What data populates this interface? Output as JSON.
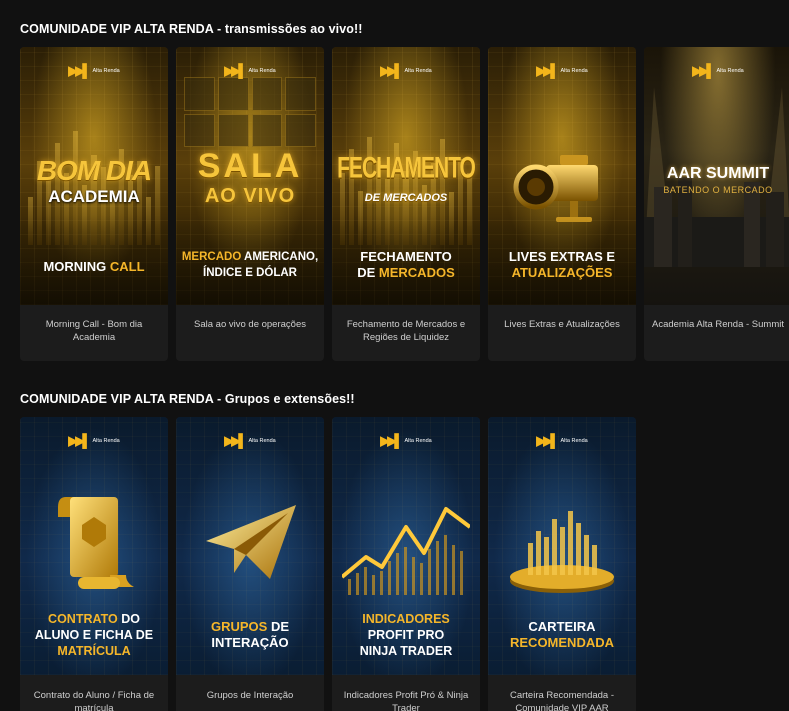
{
  "sections": [
    {
      "title": "COMUNIDADE VIP ALTA RENDA - transmissões ao vivo!!",
      "cards": [
        {
          "caption": "Morning Call - Bom dia Academia",
          "logo": "Alta Renda",
          "art_title": "BOM DIA",
          "art_sub": "ACADEMIA",
          "label_a": "MORNING ",
          "label_b": "CALL",
          "label_c": ""
        },
        {
          "caption": "Sala ao vivo de operações",
          "logo": "Alta Renda",
          "art_title": "SALA",
          "art_sub": "AO VIVO",
          "label_a": "MERCADO ",
          "label_b": "AMERICANO,",
          "label_c": "ÍNDICE E DÓLAR"
        },
        {
          "caption": "Fechamento de Mercados e Regiões de Liquidez",
          "logo": "Alta Renda",
          "art_title": "FECHAMENTO",
          "art_sub": "DE MERCADOS",
          "label_a": "FECHAMENTO",
          "label_b": "DE ",
          "label_c": "MERCADOS"
        },
        {
          "caption": "Lives Extras e Atualizações",
          "logo": "Alta Renda",
          "art_title": "",
          "art_sub": "",
          "label_a": "LIVES EXTRAS E",
          "label_b": "ATUALIZAÇÕES",
          "label_c": ""
        },
        {
          "caption": "Academia Alta Renda - Summit",
          "logo": "Alta Renda",
          "art_title": "AAR SUMMIT",
          "art_sub": "BATENDO O MERCADO",
          "label_a": "",
          "label_b": "",
          "label_c": ""
        }
      ]
    },
    {
      "title": "COMUNIDADE VIP ALTA RENDA - Grupos e extensões!!",
      "cards": [
        {
          "caption": "Contrato do Aluno / Ficha de matrícula",
          "logo": "Alta Renda",
          "label_a": "CONTRATO",
          "label_b": " DO",
          "label_c": "ALUNO E FICHA DE",
          "label_d": "MATRÍCULA"
        },
        {
          "caption": "Grupos de Interação",
          "logo": "Alta Renda",
          "label_a": "GRUPOS",
          "label_b": " DE",
          "label_c": "INTERAÇÃO",
          "label_d": ""
        },
        {
          "caption": "Indicadores Profit Pró & Ninja Trader",
          "logo": "Alta Renda",
          "label_a": "INDICADORES",
          "label_b": "",
          "label_c": "PROFIT PRO",
          "label_d": "NINJA TRADER"
        },
        {
          "caption": "Carteira Recomendada - Comunidade VIP AAR",
          "logo": "Alta Renda",
          "label_a": "CARTEIRA",
          "label_b": "",
          "label_c": "RECOMENDADA",
          "label_d": ""
        }
      ]
    }
  ],
  "colors": {
    "background": "#111111",
    "card": "#1c1c1c",
    "gold": "#f5b62a",
    "caption": "#cfcfcf"
  }
}
